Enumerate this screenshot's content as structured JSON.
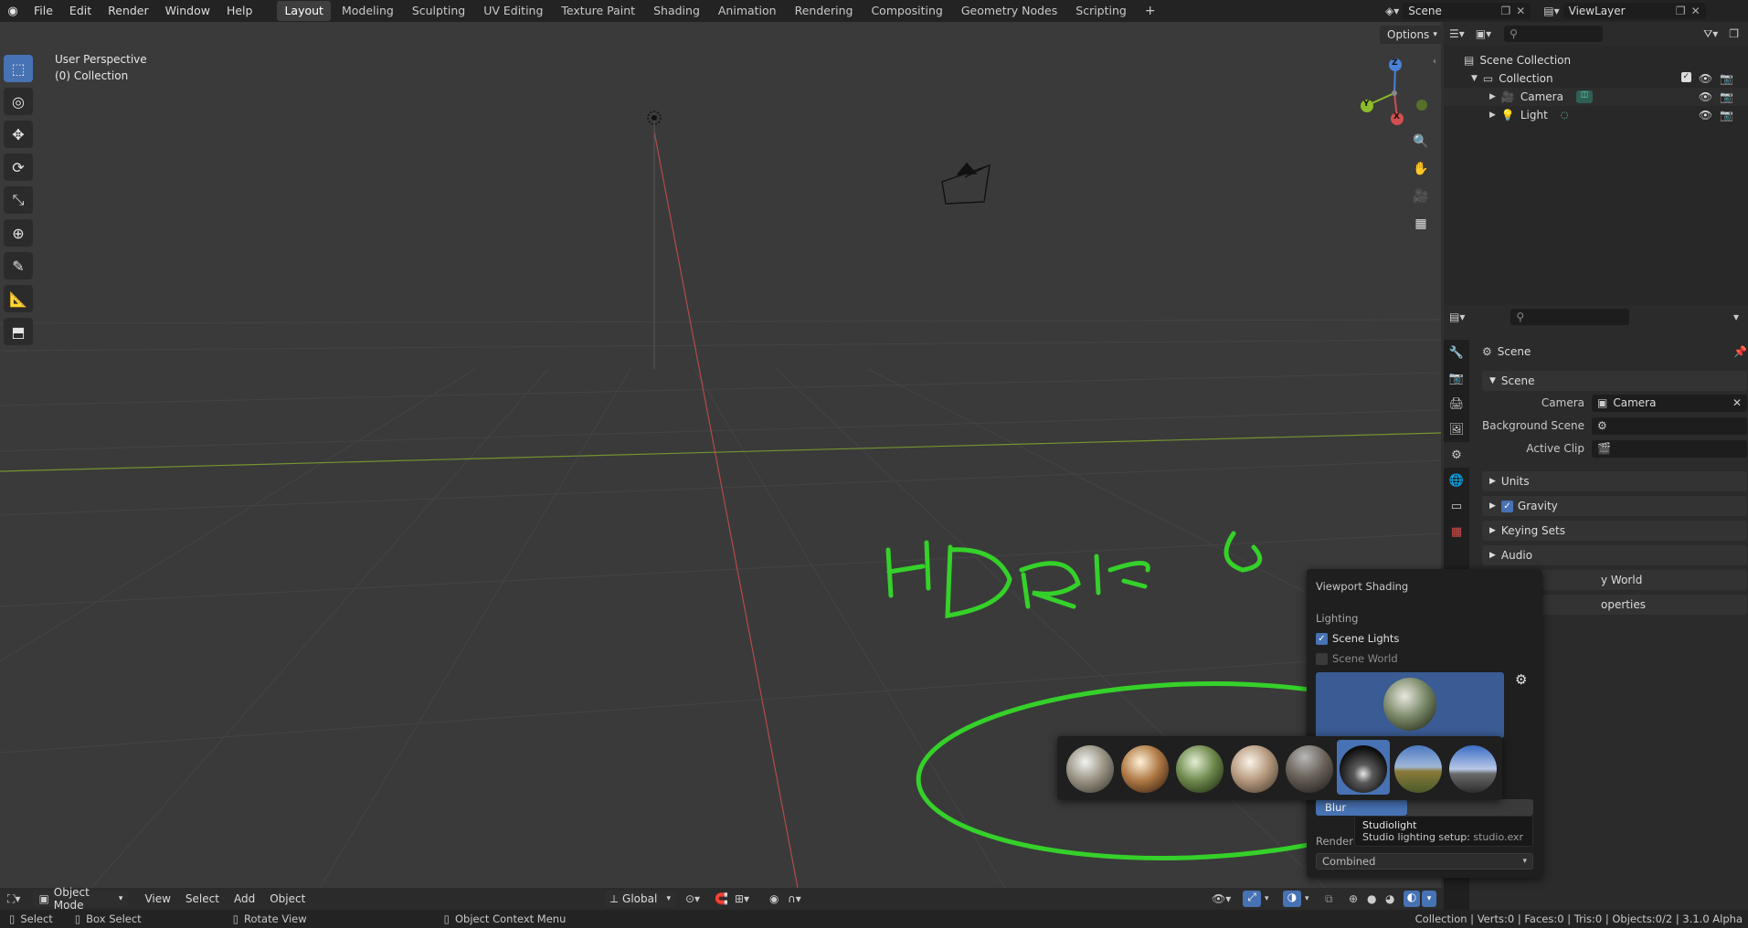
{
  "topbar": {
    "menus": [
      "File",
      "Edit",
      "Render",
      "Window",
      "Help"
    ],
    "workspaces": [
      "Layout",
      "Modeling",
      "Sculpting",
      "UV Editing",
      "Texture Paint",
      "Shading",
      "Animation",
      "Rendering",
      "Compositing",
      "Geometry Nodes",
      "Scripting"
    ],
    "active_workspace": "Layout",
    "scene_name": "Scene",
    "view_layer": "ViewLayer"
  },
  "viewport": {
    "view_name": "User Perspective",
    "collection_label": "(0) Collection",
    "options_label": "Options",
    "annotation_text": "HDRIs",
    "gizmo": {
      "x": "X",
      "y": "Y",
      "z": "Z"
    }
  },
  "outliner": {
    "root": "Scene Collection",
    "collection": "Collection",
    "items": [
      "Camera",
      "Light"
    ]
  },
  "properties": {
    "header": "Scene",
    "panel_scene": "Scene",
    "camera_label": "Camera",
    "camera_value": "Camera",
    "bg_scene_label": "Background Scene",
    "active_clip_label": "Active Clip",
    "panels": [
      "Units",
      "Gravity",
      "Keying Sets",
      "Audio",
      "Rigid Body World",
      "Custom Properties"
    ],
    "partial_world": "y World",
    "partial_custom": "operties"
  },
  "shading_popover": {
    "title": "Viewport Shading",
    "lighting": "Lighting",
    "scene_lights": "Scene Lights",
    "scene_world": "Scene World",
    "blur_label": "Blur",
    "render_pass_label": "Render Pa",
    "render_pass_value": "Combined",
    "tooltip_title": "Studiolight",
    "tooltip_body": "Studio lighting setup:",
    "tooltip_file": "studio.exr"
  },
  "viewport_header": {
    "mode": "Object Mode",
    "menus": [
      "View",
      "Select",
      "Add",
      "Object"
    ],
    "orientation": "Global"
  },
  "statusbar": {
    "select": "Select",
    "box_select": "Box Select",
    "rotate_view": "Rotate View",
    "context_menu": "Object Context Menu",
    "stats": "Collection | Verts:0 | Faces:0 | Tris:0 | Objects:0/2 | 3.1.0 Alpha"
  },
  "colors": {
    "accent": "#4772b3",
    "annotation": "#35d12a",
    "x_axis": "#d24f4f",
    "y_axis": "#8cbc2b",
    "z_axis": "#4a82d8"
  }
}
